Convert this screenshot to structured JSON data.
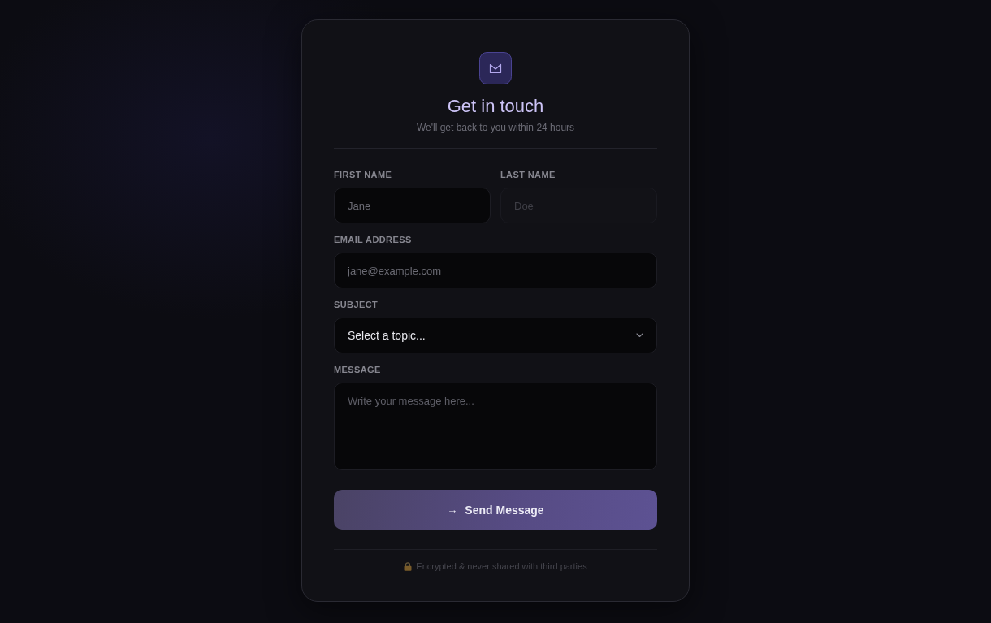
{
  "header": {
    "title": "Get in touch",
    "subtitle": "We'll get back to you within 24 hours"
  },
  "name_row": [
    {
      "kind": "input",
      "label": "FIRST NAME",
      "placeholder": "Jane",
      "disabled": false
    },
    {
      "kind": "input",
      "label": "LAST NAME",
      "placeholder": "Doe",
      "disabled": true
    }
  ],
  "fields": [
    {
      "kind": "input",
      "label": "EMAIL ADDRESS",
      "placeholder": "jane@example.com",
      "disabled": false
    },
    {
      "kind": "select",
      "label": "SUBJECT",
      "value": "Select a topic...",
      "disabled": false
    },
    {
      "kind": "textarea",
      "label": "MESSAGE",
      "placeholder": "Write your message here...",
      "disabled": false
    }
  ],
  "submit": {
    "arrow": "→",
    "label": "Send Message"
  },
  "footer": {
    "note": "Encrypted & never shared with third parties"
  }
}
